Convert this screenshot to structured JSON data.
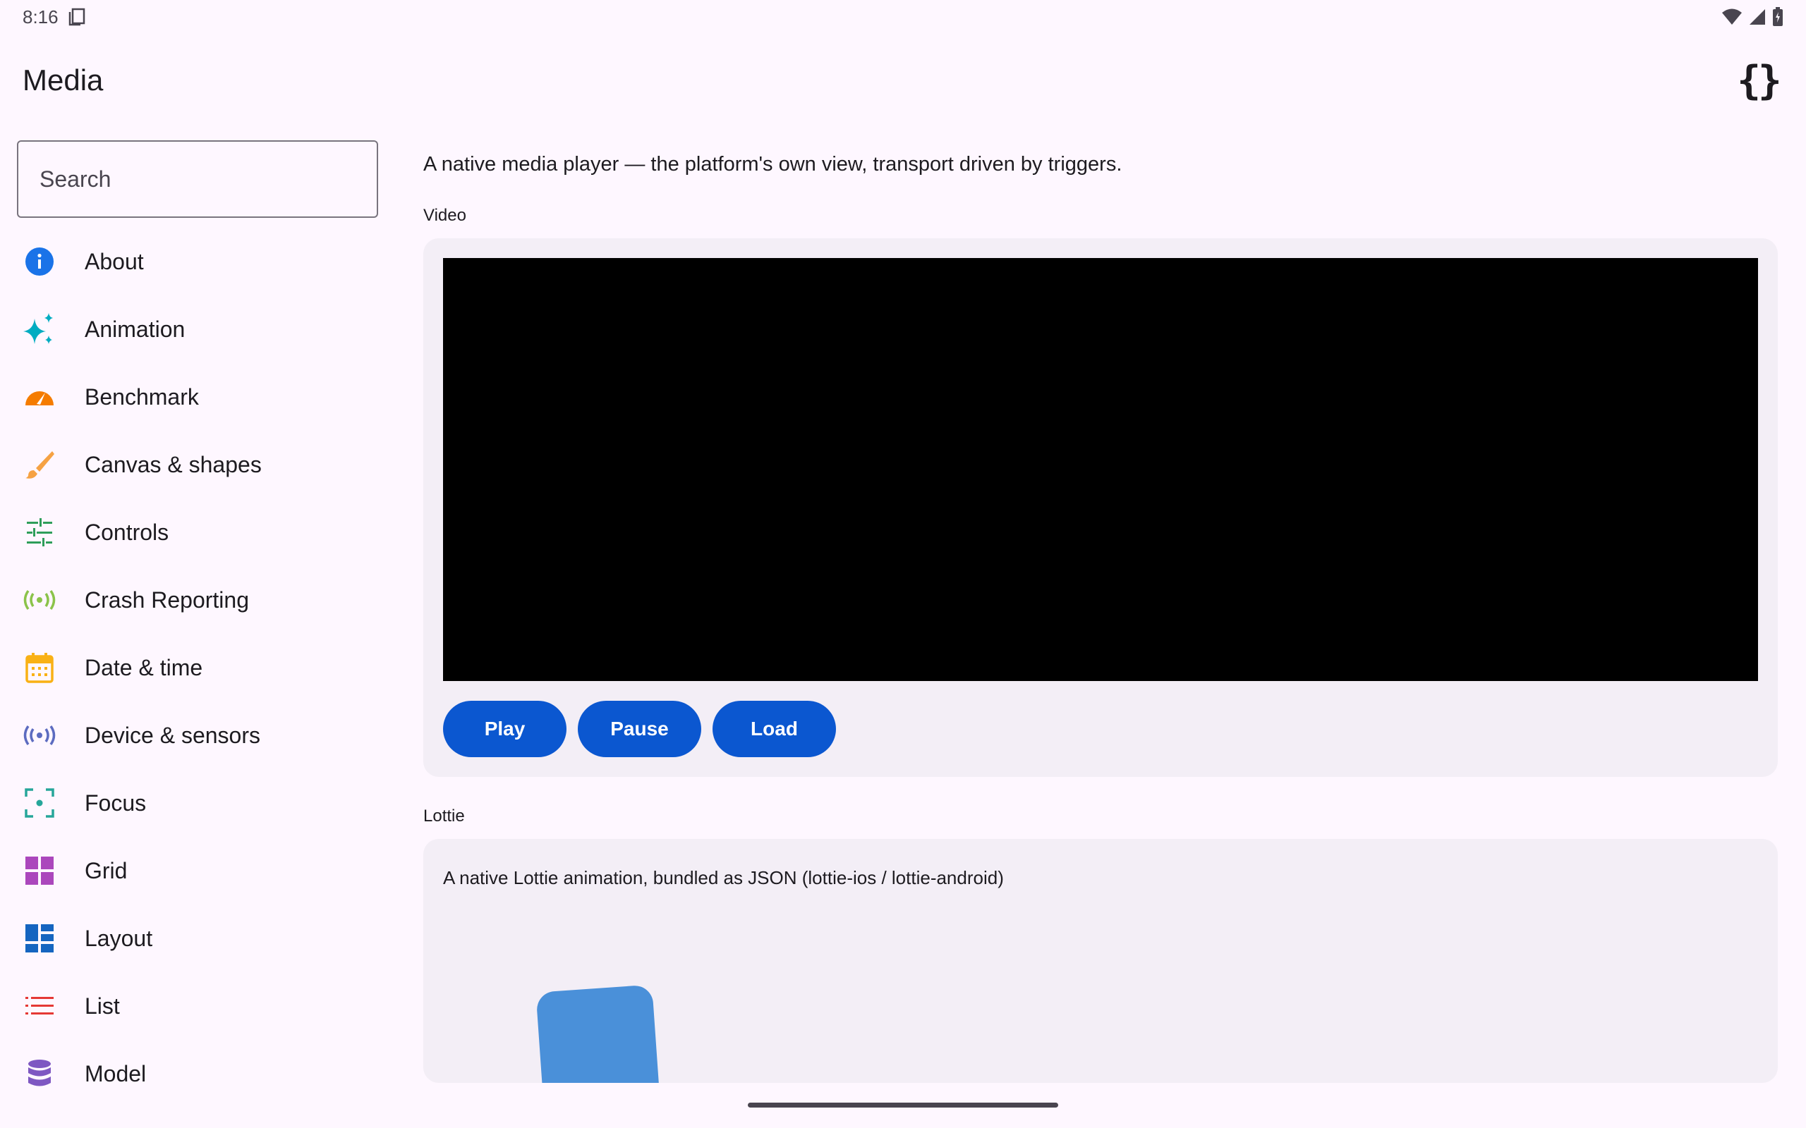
{
  "status": {
    "time": "8:16"
  },
  "app": {
    "title": "Media"
  },
  "search": {
    "placeholder": "Search"
  },
  "nav": {
    "items": [
      {
        "label": "About",
        "icon": "info-icon",
        "color": "#1a73e8"
      },
      {
        "label": "Animation",
        "icon": "sparkle-icon",
        "color": "#00acc1"
      },
      {
        "label": "Benchmark",
        "icon": "speedometer-icon",
        "color": "#f57c00"
      },
      {
        "label": "Canvas & shapes",
        "icon": "brush-icon",
        "color": "#f6a243"
      },
      {
        "label": "Controls",
        "icon": "sliders-icon",
        "color": "#2e9e5a"
      },
      {
        "label": "Crash Reporting",
        "icon": "broadcast-icon",
        "color": "#8bc34a"
      },
      {
        "label": "Date & time",
        "icon": "calendar-icon",
        "color": "#f9b115"
      },
      {
        "label": "Device & sensors",
        "icon": "sensor-icon",
        "color": "#5c6bc0"
      },
      {
        "label": "Focus",
        "icon": "focus-icon",
        "color": "#26a69a"
      },
      {
        "label": "Grid",
        "icon": "grid-icon",
        "color": "#ab47bc"
      },
      {
        "label": "Layout",
        "icon": "layout-icon",
        "color": "#1565c0"
      },
      {
        "label": "List",
        "icon": "list-icon",
        "color": "#e53935"
      },
      {
        "label": "Model",
        "icon": "database-icon",
        "color": "#7e57c2"
      }
    ]
  },
  "main": {
    "description": "A native media player — the platform's own view, transport driven by triggers.",
    "video_section": {
      "label": "Video",
      "buttons": {
        "play": "Play",
        "pause": "Pause",
        "load": "Load"
      }
    },
    "lottie_section": {
      "label": "Lottie",
      "description": "A native Lottie animation, bundled as JSON (lottie-ios / lottie-android)"
    }
  },
  "colors": {
    "accent": "#0b57d0",
    "background": "#fef7ff",
    "card": "#f3eef6"
  }
}
